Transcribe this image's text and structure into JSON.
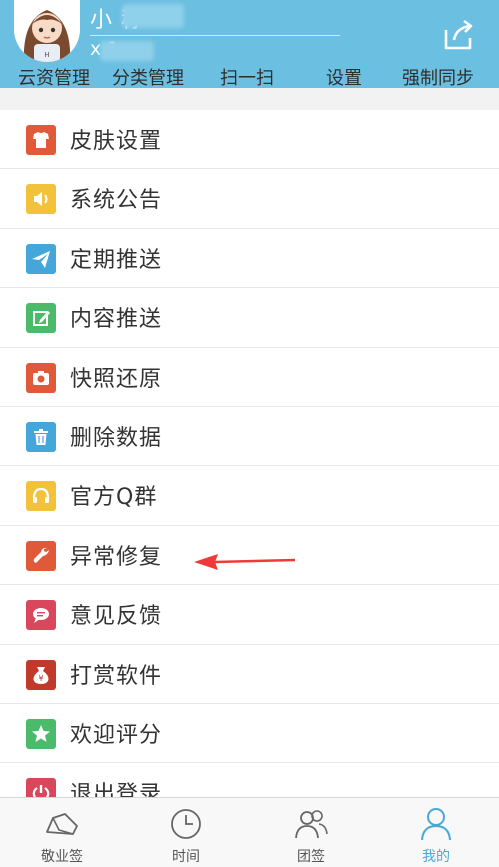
{
  "header": {
    "nickname": "小     称",
    "user_id": "x       1",
    "menu": [
      "云资管理",
      "分类管理",
      "扫一扫",
      "设置",
      "强制同步"
    ]
  },
  "menu_items": [
    {
      "label": "皮肤设置",
      "icon": "shirt-icon",
      "color": "#e05a3a"
    },
    {
      "label": "系统公告",
      "icon": "speaker-icon",
      "color": "#f2c23a"
    },
    {
      "label": "定期推送",
      "icon": "paper-plane-icon",
      "color": "#45a6d9"
    },
    {
      "label": "内容推送",
      "icon": "edit-icon",
      "color": "#4cba6b"
    },
    {
      "label": "快照还原",
      "icon": "camera-icon",
      "color": "#e05a3a"
    },
    {
      "label": "删除数据",
      "icon": "trash-icon",
      "color": "#45a6d9"
    },
    {
      "label": "官方Q群",
      "icon": "headset-icon",
      "color": "#f2c23a"
    },
    {
      "label": "异常修复",
      "icon": "wrench-icon",
      "color": "#e05a3a"
    },
    {
      "label": "意见反馈",
      "icon": "chat-bubble-icon",
      "color": "#d8475c"
    },
    {
      "label": "打赏软件",
      "icon": "money-bag-icon",
      "color": "#c0392b"
    },
    {
      "label": "欢迎评分",
      "icon": "star-icon",
      "color": "#4cba6b"
    },
    {
      "label": "退出登录",
      "icon": "power-icon",
      "color": "#d8475c"
    }
  ],
  "tabs": [
    {
      "label": "敬业签",
      "icon": "note-tab-icon",
      "active": false
    },
    {
      "label": "时间",
      "icon": "clock-tab-icon",
      "active": false
    },
    {
      "label": "团签",
      "icon": "group-tab-icon",
      "active": false
    },
    {
      "label": "我的",
      "icon": "person-tab-icon",
      "active": true
    }
  ],
  "colors": {
    "header": "#6bbfe0",
    "accent": "#4aa8d8",
    "arrow": "#f03a3a"
  }
}
